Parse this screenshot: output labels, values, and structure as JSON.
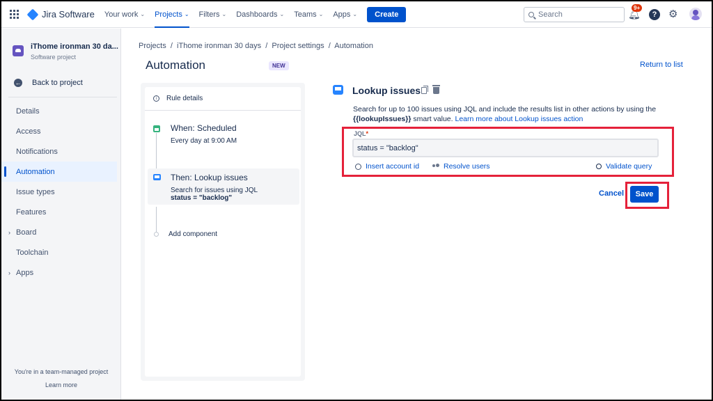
{
  "nav": {
    "product": "Jira Software",
    "items": [
      {
        "label": "Your work",
        "active": false
      },
      {
        "label": "Projects",
        "active": true
      },
      {
        "label": "Filters",
        "active": false
      },
      {
        "label": "Dashboards",
        "active": false
      },
      {
        "label": "Teams",
        "active": false
      },
      {
        "label": "Apps",
        "active": false
      }
    ],
    "create_label": "Create",
    "search_placeholder": "Search",
    "notification_badge": "9+",
    "help_glyph": "?"
  },
  "sidebar": {
    "project_name": "iThome ironman 30 da...",
    "project_type": "Software project",
    "back_label": "Back to project",
    "items": [
      {
        "label": "Details",
        "active": false
      },
      {
        "label": "Access",
        "active": false
      },
      {
        "label": "Notifications",
        "active": false
      },
      {
        "label": "Automation",
        "active": true
      },
      {
        "label": "Issue types",
        "active": false
      },
      {
        "label": "Features",
        "active": false
      },
      {
        "label": "Board",
        "active": false,
        "expandable": true
      },
      {
        "label": "Toolchain",
        "active": false
      },
      {
        "label": "Apps",
        "active": false,
        "expandable": true
      }
    ],
    "team_note": "You're in a team-managed project",
    "learn_more": "Learn more"
  },
  "breadcrumb": [
    "Projects",
    "iThome ironman 30 days",
    "Project settings",
    "Automation"
  ],
  "page": {
    "title": "Automation",
    "badge": "NEW",
    "return_link": "Return to list"
  },
  "rule": {
    "details_label": "Rule details",
    "trigger_title": "When: Scheduled",
    "trigger_sub": "Every day at 9:00 AM",
    "action_title": "Then: Lookup issues",
    "action_sub": "Search for issues using JQL",
    "action_jql": "status = \"backlog\"",
    "add_component": "Add component"
  },
  "component": {
    "title": "Lookup issues",
    "desc_prefix": "Search for up to 100 issues using JQL and include the results list in other actions by using the",
    "desc_smart": "{{lookupIssues}}",
    "desc_mid": "smart value.",
    "desc_link": "Learn more about Lookup issues action",
    "jql_label": "JQL",
    "jql_required": "*",
    "jql_value": "status = \"backlog\"",
    "link_insert": "Insert account id",
    "link_resolve": "Resolve users",
    "link_validate": "Validate query",
    "cancel_label": "Cancel",
    "save_label": "Save"
  },
  "colors": {
    "accent": "#0052CC",
    "highlight": "#E5213A"
  }
}
